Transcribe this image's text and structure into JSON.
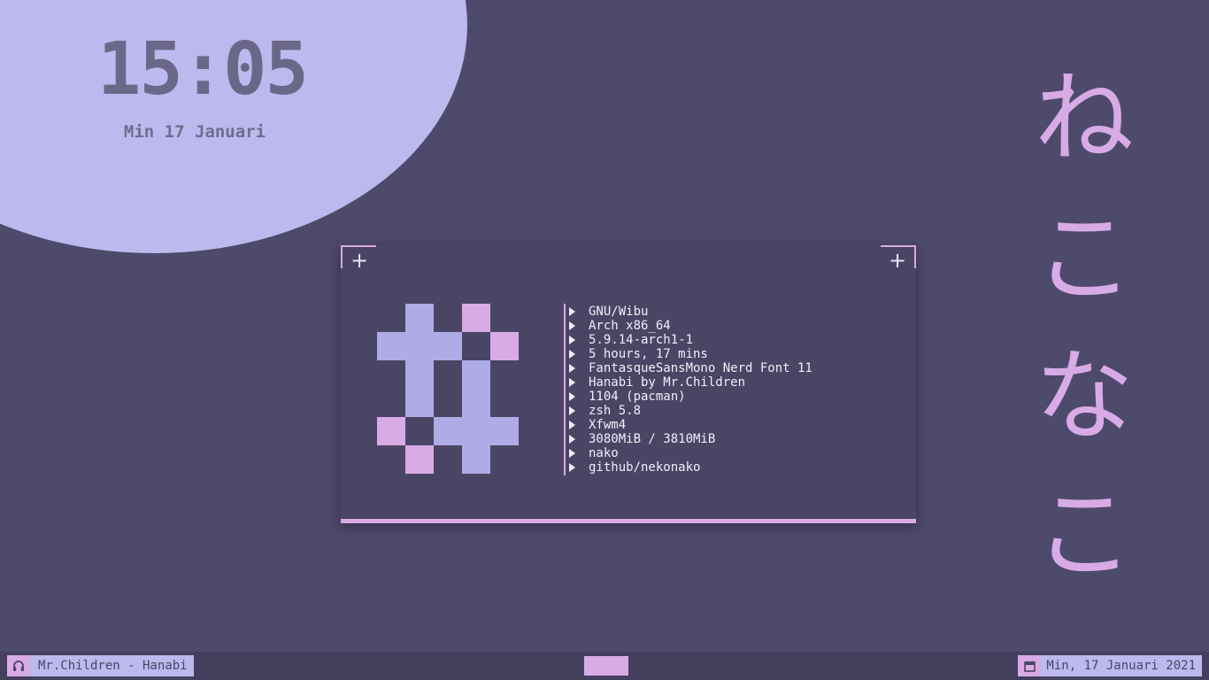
{
  "clock": {
    "time": "15:05",
    "date": "Min 17 Januari"
  },
  "kana": [
    "ね",
    "こ",
    "な",
    "こ"
  ],
  "terminal": {
    "info": [
      "GNU/Wibu",
      "Arch x86_64",
      "5.9.14-arch1-1",
      "5 hours, 17 mins",
      "FantasqueSansMono Nerd Font 11",
      "Hanabi by Mr.Children",
      "1104 (pacman)",
      "zsh 5.8",
      "Xfwm4",
      "3080MiB / 3810MiB",
      "nako",
      "github/nekonako"
    ]
  },
  "panel": {
    "now_playing": "Mr.Children - Hanabi",
    "date": "Min, 17 Januari 2021"
  },
  "icons": {
    "music": "headphones-icon",
    "date": "calendar-icon",
    "maximize": "plus-icon"
  },
  "colors": {
    "background": "#4e4a6b",
    "accent_pink": "#d8abe6",
    "accent_lavender": "#bcb9ee",
    "logo_blue": "#aeabe6",
    "terminal_bg": "#4a4564",
    "panel_bg": "#433f5d"
  }
}
